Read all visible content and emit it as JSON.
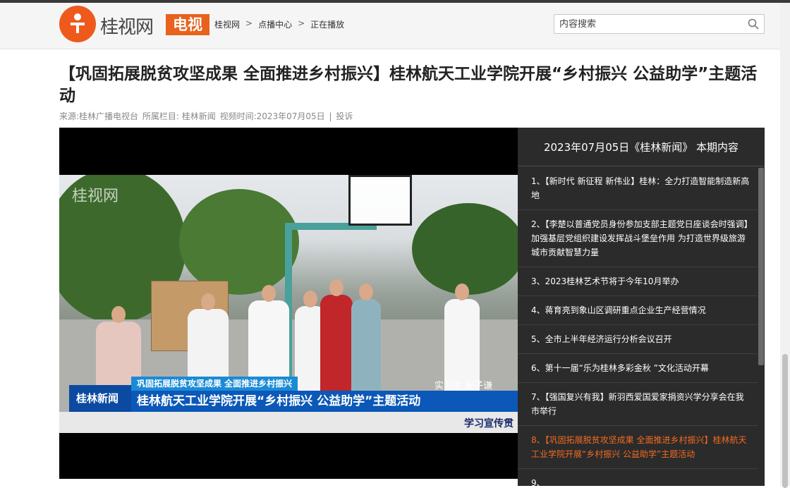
{
  "site": {
    "logo_text": "桂视网",
    "logo_tv": "电视"
  },
  "breadcrumb": [
    "桂视网",
    "点播中心",
    "正在播放"
  ],
  "breadcrumb_sep": ">",
  "search": {
    "placeholder": "内容搜索"
  },
  "page_title": "【巩固拓展脱贫攻坚成果 全面推进乡村振兴】桂林航天工业学院开展“乡村振兴 公益助学”主题活动",
  "meta": {
    "source": "来源:桂林广播电视台",
    "column": "所属栏目: 桂林新闻",
    "time": "视频时间:2023年07月05日",
    "sep": "|",
    "report": "投诉"
  },
  "video": {
    "watermark": "桂视网",
    "caption_top": "巩固拓展脱贫攻坚成果 全面推进乡村振兴",
    "caption_logo": "桂林新闻",
    "caption_main": "桂林航天工业学院开展“乡村振兴 公益助学”主题活动",
    "reporter": "实习生 安子谦",
    "ticker": "学习宣传贯"
  },
  "playlist": {
    "header": "2023年07月05日《桂林新闻》 本期内容",
    "items": [
      {
        "text": "1、【新时代 新征程 新伟业】桂林：全力打造智能制造新高地",
        "active": false
      },
      {
        "text": "2、【李楚以普通党员身份参加支部主题党日座谈会时强调】加强基层党组织建设发挥战斗堡垒作用 为打造世界级旅游城市贡献智慧力量",
        "active": false
      },
      {
        "text": "3、2023桂林艺术节将于今年10月举办",
        "active": false
      },
      {
        "text": "4、蒋育亮到象山区调研重点企业生产经营情况",
        "active": false
      },
      {
        "text": "5、全市上半年经济运行分析会议召开",
        "active": false
      },
      {
        "text": "6、第十一届“乐为桂林多彩金秋 ”文化活动开幕",
        "active": false
      },
      {
        "text": "7、【强国复兴有我】新羽西爱国爱家捐资兴学分享会在我市举行",
        "active": false
      },
      {
        "text": "8、【巩固拓展脱贫攻坚成果 全面推进乡村振兴】桂林航天工业学院开展“乡村振兴 公益助学”主题活动",
        "active": true
      },
      {
        "text": "9、",
        "active": false
      }
    ]
  },
  "colors": {
    "accent": "#ee5a1c",
    "active_item": "#f26a21",
    "caption_blue": "#0b58b8"
  }
}
